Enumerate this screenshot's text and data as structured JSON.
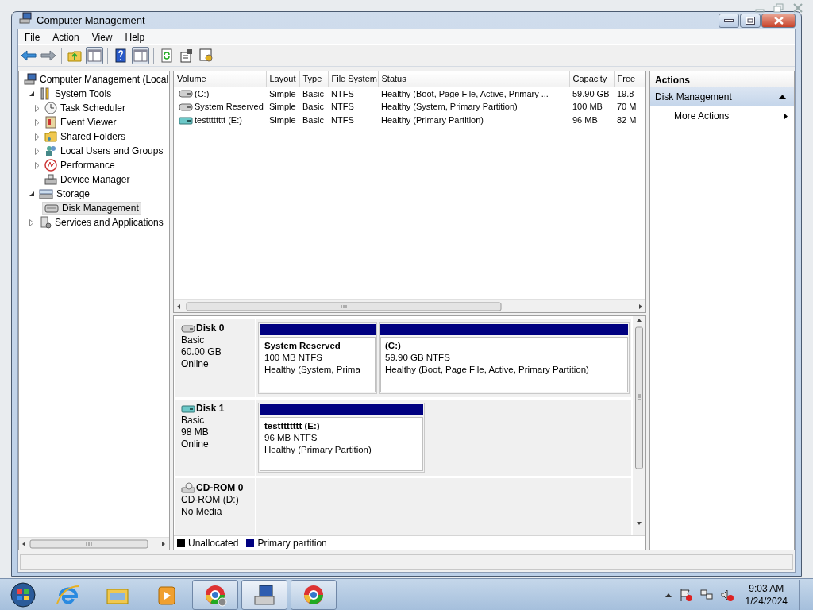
{
  "window": {
    "title": "Computer Management"
  },
  "menu": [
    "File",
    "Action",
    "View",
    "Help"
  ],
  "toolbar": [
    {
      "kind": "back",
      "pressed": false
    },
    {
      "kind": "forward",
      "pressed": false
    },
    {
      "kind": "sep"
    },
    {
      "kind": "folder-up",
      "pressed": false
    },
    {
      "kind": "tree-pane",
      "pressed": true
    },
    {
      "kind": "sep"
    },
    {
      "kind": "help",
      "pressed": false
    },
    {
      "kind": "action-pane",
      "pressed": true
    },
    {
      "kind": "sep"
    },
    {
      "kind": "refresh",
      "pressed": false
    },
    {
      "kind": "properties",
      "pressed": false
    },
    {
      "kind": "settings",
      "pressed": false
    }
  ],
  "tree": [
    {
      "label": "Computer Management (Local",
      "kind": "computer",
      "selected": false,
      "children": [
        {
          "label": "System Tools",
          "kind": "tools",
          "expanded": true,
          "selected": false,
          "children": [
            {
              "label": "Task Scheduler",
              "kind": "clock",
              "expanded": false,
              "selected": false
            },
            {
              "label": "Event Viewer",
              "kind": "event",
              "expanded": false,
              "selected": false
            },
            {
              "label": "Shared Folders",
              "kind": "folder",
              "expanded": false,
              "selected": false
            },
            {
              "label": "Local Users and Groups",
              "kind": "users",
              "expanded": false,
              "selected": false
            },
            {
              "label": "Performance",
              "kind": "perf",
              "expanded": false,
              "selected": false
            },
            {
              "label": "Device Manager",
              "kind": "device",
              "selected": false
            }
          ]
        },
        {
          "label": "Storage",
          "kind": "storage",
          "expanded": true,
          "selected": false,
          "children": [
            {
              "label": "Disk Management",
              "kind": "disk",
              "selected": true
            }
          ]
        },
        {
          "label": "Services and Applications",
          "kind": "services",
          "expanded": false,
          "selected": false
        }
      ]
    }
  ],
  "volumes": {
    "columns": [
      "Volume",
      "Layout",
      "Type",
      "File System",
      "Status",
      "Capacity",
      "Free"
    ],
    "rows": [
      {
        "kind": "hdd",
        "cells": [
          "(C:)",
          "Simple",
          "Basic",
          "NTFS",
          "Healthy (Boot, Page File, Active, Primary ...",
          "59.90 GB",
          "19.8"
        ]
      },
      {
        "kind": "hdd",
        "cells": [
          "System Reserved",
          "Simple",
          "Basic",
          "NTFS",
          "Healthy (System, Primary Partition)",
          "100 MB",
          "70 M"
        ]
      },
      {
        "kind": "vhd",
        "cells": [
          "testttttttt (E:)",
          "Simple",
          "Basic",
          "NTFS",
          "Healthy (Primary Partition)",
          "96 MB",
          "82 M"
        ]
      }
    ]
  },
  "disks": [
    {
      "name": "Disk 0",
      "kind": "hdd",
      "type": "Basic",
      "size": "60.00 GB",
      "status": "Online",
      "partitions": [
        {
          "name": "System Reserved",
          "size": "100 MB NTFS",
          "status": "Healthy (System, Prima"
        },
        {
          "name": "(C:)",
          "size": "59.90 GB NTFS",
          "status": "Healthy (Boot, Page File, Active, Primary Partition)"
        }
      ]
    },
    {
      "name": "Disk 1",
      "kind": "vhd",
      "type": "Basic",
      "size": "98 MB",
      "status": "Online",
      "partitions": [
        {
          "name": "testttttttt  (E:)",
          "size": "96 MB NTFS",
          "status": "Healthy (Primary Partition)"
        }
      ]
    },
    {
      "name": "CD-ROM 0",
      "kind": "cdrom",
      "type": "CD-ROM (D:)",
      "status": "No Media"
    }
  ],
  "legend": [
    {
      "label": "Unallocated",
      "color": "#000000"
    },
    {
      "label": "Primary partition",
      "color": "#000080"
    }
  ],
  "actions": {
    "title": "Actions",
    "section": "Disk Management",
    "items": [
      "More Actions"
    ]
  },
  "taskbar": {
    "buttons": [
      {
        "kind": "ie",
        "running": false,
        "selected": false
      },
      {
        "kind": "explorer",
        "running": false,
        "selected": false
      },
      {
        "kind": "media",
        "running": false,
        "selected": false
      },
      {
        "kind": "chrome-profile",
        "running": true,
        "selected": false
      },
      {
        "kind": "computer",
        "running": true,
        "selected": true
      },
      {
        "kind": "chrome",
        "running": true,
        "selected": false
      }
    ],
    "time": "9:03 AM",
    "date": "1/24/2024"
  }
}
